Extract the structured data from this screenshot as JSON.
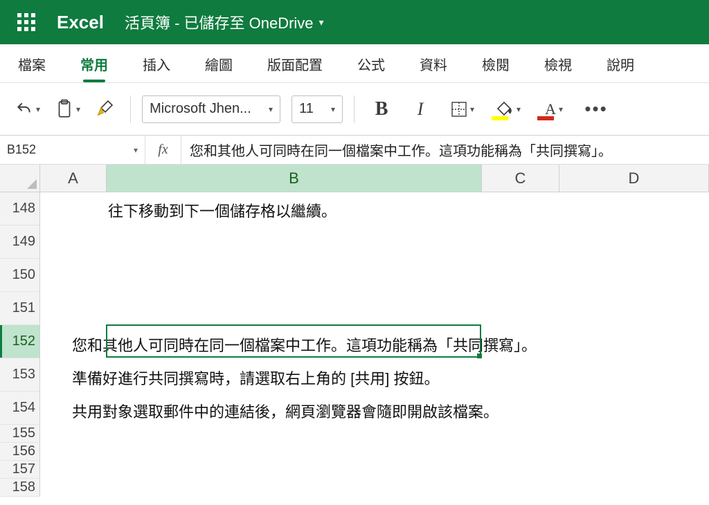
{
  "titlebar": {
    "app_name": "Excel",
    "doc_title": "活頁簿  -  已儲存至 OneDrive"
  },
  "tabs": {
    "items": [
      "檔案",
      "常用",
      "插入",
      "繪圖",
      "版面配置",
      "公式",
      "資料",
      "檢閱",
      "檢視",
      "說明"
    ],
    "active_index": 1
  },
  "ribbon": {
    "font_name": "Microsoft Jhen...",
    "font_size": "11"
  },
  "formula_bar": {
    "cell_ref": "B152",
    "fx": "fx",
    "content": "您和其他人可同時在同一個檔案中工作。這項功能稱為「共同撰寫」。"
  },
  "columns": [
    "A",
    "B",
    "C",
    "D"
  ],
  "selected_column": "B",
  "rows": {
    "labels": [
      "148",
      "149",
      "150",
      "151",
      "152",
      "153",
      "154",
      "155",
      "156",
      "157",
      "158"
    ],
    "selected_label": "152"
  },
  "cells": {
    "ghost_148": "往下移動到下一個儲存格以繼續。",
    "b152": "您和其他人可同時在同一個檔案中工作。這項功能稱為「共同撰寫」。",
    "b153": "準備好進行共同撰寫時，請選取右上角的 [共用] 按鈕。",
    "b154": "共用對象選取郵件中的連結後，網頁瀏覽器會隨即開啟該檔案。"
  }
}
